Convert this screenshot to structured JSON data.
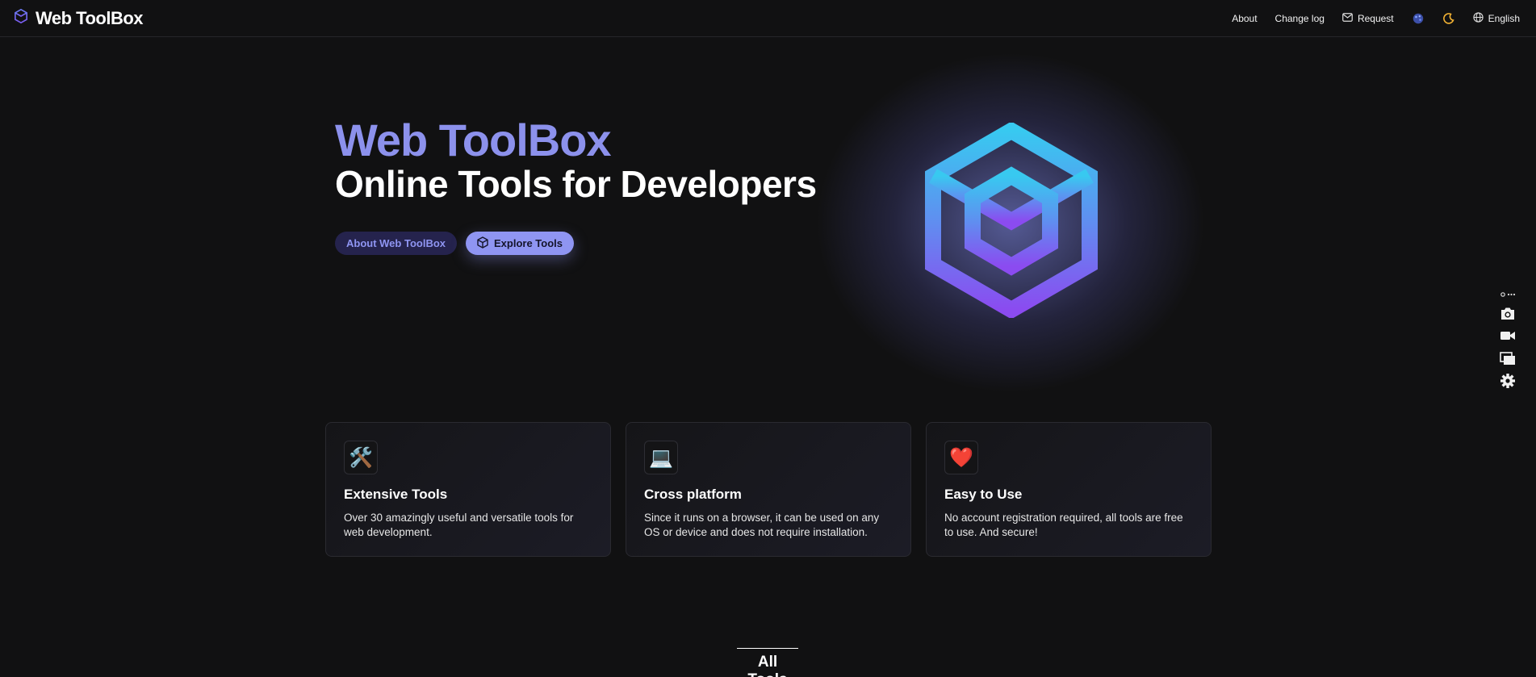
{
  "header": {
    "brand": "Web ToolBox",
    "nav": {
      "about": "About",
      "changelog": "Change log",
      "request": "Request",
      "language": "English"
    }
  },
  "hero": {
    "title": "Web ToolBox",
    "subtitle": "Online Tools for Developers",
    "about_button": "About Web ToolBox",
    "explore_button": "Explore Tools"
  },
  "features": [
    {
      "icon": "🛠️",
      "title": "Extensive Tools",
      "description": "Over 30 amazingly useful and versatile tools for web development."
    },
    {
      "icon": "💻",
      "title": "Cross platform",
      "description": "Since it runs on a browser, it can be used on any OS or device and does not require installation."
    },
    {
      "icon": "❤️",
      "title": "Easy to Use",
      "description": "No account registration required, all tools are free to use. And secure!"
    }
  ],
  "section": {
    "all_tools": "All Tools"
  },
  "colors": {
    "accent": "#8c91ec",
    "background": "#111112",
    "logo_top": "#38c9f0",
    "logo_bottom": "#8b4bf0"
  }
}
